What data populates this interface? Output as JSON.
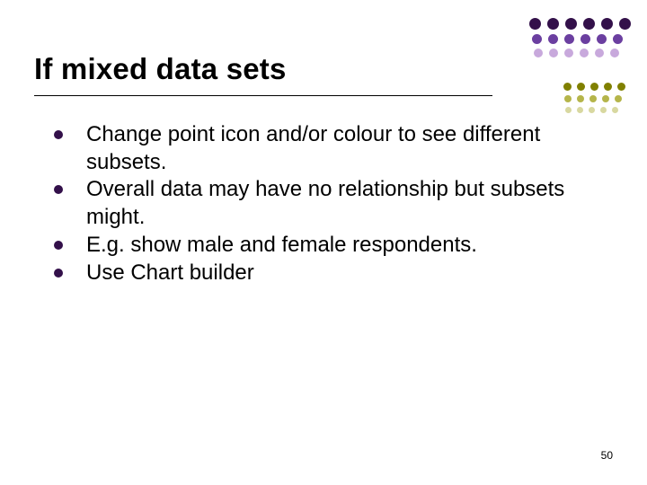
{
  "slide": {
    "title": "If mixed data sets",
    "bullets": [
      "Change point icon and/or colour to see different subsets.",
      "Overall data may have no relationship but subsets might.",
      "E.g. show male and female respondents.",
      "Use Chart builder"
    ],
    "page_number": "50"
  },
  "decor": {
    "colors": {
      "purple_d": "#33104a",
      "purple_m": "#6b3fa0",
      "purple_l": "#c8a9dc",
      "olive_d": "#808000",
      "olive_m": "#b5b54a",
      "olive_l": "#d8d8a0"
    }
  }
}
